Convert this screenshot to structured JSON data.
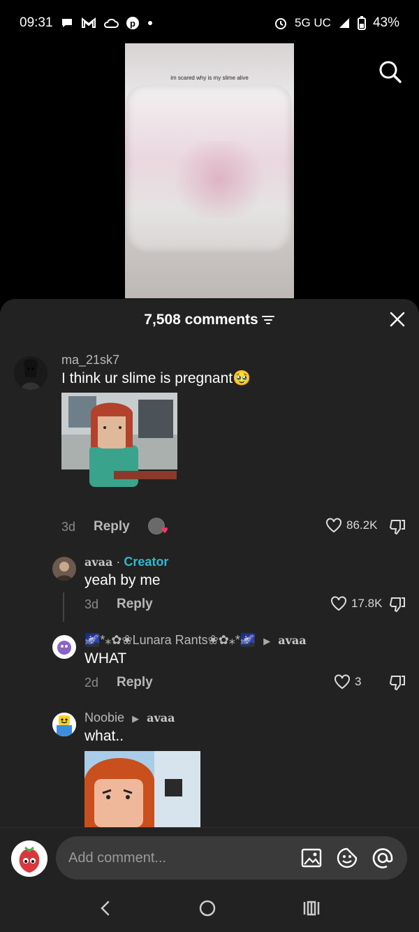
{
  "status": {
    "time": "09:31",
    "network": "5G UC",
    "battery": "43%"
  },
  "video": {
    "caption": "im scared why is my slime alive"
  },
  "sheet": {
    "title": "7,508 comments"
  },
  "comments": [
    {
      "username": "ma_21sk7",
      "text": "I think ur slime is pregnant🥹",
      "age": "3d",
      "reply_label": "Reply",
      "likes": "86.2K"
    },
    {
      "username": "avaa",
      "badge": "Creator",
      "text": "yeah by me",
      "age": "3d",
      "reply_label": "Reply",
      "likes": "17.8K"
    },
    {
      "username": "🌌*⁎✿❀Lunara Rants❀✿⁎*🌌",
      "reply_to": "avaa",
      "text": "WHAT",
      "age": "2d",
      "reply_label": "Reply",
      "likes": "3"
    },
    {
      "username": "Noobie",
      "reply_to": "avaa",
      "text": "what.."
    }
  ],
  "input": {
    "placeholder": "Add comment..."
  },
  "colors": {
    "sheet_bg": "#222222",
    "creator_accent": "#2fb9d0",
    "like_heart": "#ff3366"
  }
}
